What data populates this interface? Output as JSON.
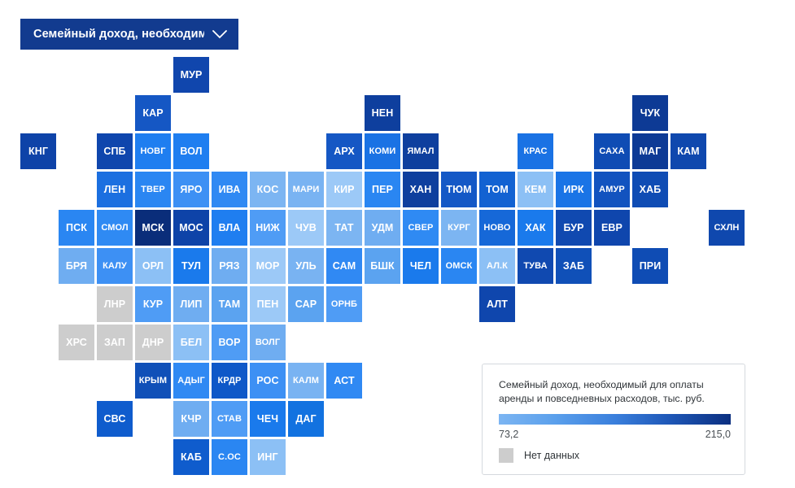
{
  "dropdown": {
    "label": "Семейный доход, необходим...",
    "icon": "chevron-down-icon",
    "bg_color": "#123b8f"
  },
  "legend": {
    "title": "Семейный доход, необходимый для оплаты аренды и повседневных расходов, тыс. руб.",
    "min_label": "73,2",
    "max_label": "215,0",
    "nodata_label": "Нет данных",
    "nodata_color": "#cdcdcd",
    "ramp_start_color": "#7cb5f2",
    "ramp_end_color": "#0b2f80"
  },
  "chart_data": {
    "type": "heatmap",
    "title": "Семейный доход, необходимый для оплаты аренды и повседневных расходов, тыс. руб.",
    "xlabel": "",
    "ylabel": "",
    "value_unit": "тыс. руб.",
    "vmin": 73.2,
    "vmax": 215.0,
    "grid": false,
    "legend_position": "bottom-right",
    "colormap": [
      "#7cb5f2",
      "#0b2f80"
    ],
    "nodata_color": "#cdcdcd",
    "cell_size": 44,
    "cell_pitch": 47,
    "origin": [
      25,
      70
    ],
    "tiles": [
      {
        "label": "МУР",
        "col": 4,
        "row": 0,
        "color": "#1046ad",
        "value": 140.0
      },
      {
        "label": "КАР",
        "col": 3,
        "row": 1,
        "color": "#1557c4",
        "value": 128.0
      },
      {
        "label": "НЕН",
        "col": 9,
        "row": 1,
        "color": "#0e3f9e",
        "value": 152.0
      },
      {
        "label": "ЧУК",
        "col": 16,
        "row": 1,
        "color": "#0d3a95",
        "value": 158.0
      },
      {
        "label": "КНГ",
        "col": 0,
        "row": 2,
        "color": "#0e43a8",
        "value": 146.0
      },
      {
        "label": "СПБ",
        "col": 2,
        "row": 2,
        "color": "#0f46ad",
        "value": 143.0
      },
      {
        "label": "НОВГ",
        "col": 3,
        "row": 2,
        "color": "#1f7ef0",
        "value": 106.0
      },
      {
        "label": "ВОЛ",
        "col": 4,
        "row": 2,
        "color": "#1f7ef0",
        "value": 105.0
      },
      {
        "label": "АРХ",
        "col": 8,
        "row": 2,
        "color": "#1557c4",
        "value": 129.0
      },
      {
        "label": "КОМИ",
        "col": 9,
        "row": 2,
        "color": "#1a72e4",
        "value": 113.0
      },
      {
        "label": "ЯМАЛ",
        "col": 10,
        "row": 2,
        "color": "#0e3f9e",
        "value": 151.0
      },
      {
        "label": "КРАС",
        "col": 13,
        "row": 2,
        "color": "#1a72e4",
        "value": 112.0
      },
      {
        "label": "САХА",
        "col": 15,
        "row": 2,
        "color": "#0f4cb4",
        "value": 140.0
      },
      {
        "label": "МАГ",
        "col": 16,
        "row": 2,
        "color": "#0d3a95",
        "value": 157.0
      },
      {
        "label": "КАМ",
        "col": 17,
        "row": 2,
        "color": "#0f48ae",
        "value": 144.0
      },
      {
        "label": "ЛЕН",
        "col": 2,
        "row": 3,
        "color": "#1b6fe0",
        "value": 115.0
      },
      {
        "label": "ТВЕР",
        "col": 3,
        "row": 3,
        "color": "#2a86f2",
        "value": 101.0
      },
      {
        "label": "ЯРО",
        "col": 4,
        "row": 3,
        "color": "#3d90f4",
        "value": 96.0
      },
      {
        "label": "ИВА",
        "col": 5,
        "row": 3,
        "color": "#3089f3",
        "value": 99.0
      },
      {
        "label": "КОС",
        "col": 6,
        "row": 3,
        "color": "#7cb5f2",
        "value": 82.0
      },
      {
        "label": "МАРИ",
        "col": 7,
        "row": 3,
        "color": "#79b3f2",
        "value": 83.0
      },
      {
        "label": "КИР",
        "col": 8,
        "row": 3,
        "color": "#9cc9f7",
        "value": 77.0
      },
      {
        "label": "ПЕР",
        "col": 9,
        "row": 3,
        "color": "#2a86f2",
        "value": 101.0
      },
      {
        "label": "ХАН",
        "col": 10,
        "row": 3,
        "color": "#0e3f9e",
        "value": 150.0
      },
      {
        "label": "ТЮМ",
        "col": 11,
        "row": 3,
        "color": "#1458c6",
        "value": 128.0
      },
      {
        "label": "ТОМ",
        "col": 12,
        "row": 3,
        "color": "#1262d2",
        "value": 123.0
      },
      {
        "label": "КЕМ",
        "col": 13,
        "row": 3,
        "color": "#8cc0f5",
        "value": 80.0
      },
      {
        "label": "ИРК",
        "col": 14,
        "row": 3,
        "color": "#1a74e6",
        "value": 112.0
      },
      {
        "label": "АМУР",
        "col": 15,
        "row": 3,
        "color": "#1253bf",
        "value": 131.0
      },
      {
        "label": "ХАБ",
        "col": 16,
        "row": 3,
        "color": "#0f4cb4",
        "value": 139.0
      },
      {
        "label": "ПСК",
        "col": 1,
        "row": 4,
        "color": "#2a86f2",
        "value": 100.0
      },
      {
        "label": "СМОЛ",
        "col": 2,
        "row": 4,
        "color": "#2f8af3",
        "value": 99.0
      },
      {
        "label": "МСК",
        "col": 3,
        "row": 4,
        "color": "#0a2d7a",
        "value": 215.0
      },
      {
        "label": "МОС",
        "col": 4,
        "row": 4,
        "color": "#0e43a8",
        "value": 147.0
      },
      {
        "label": "ВЛА",
        "col": 5,
        "row": 4,
        "color": "#1f7ef0",
        "value": 106.0
      },
      {
        "label": "НИЖ",
        "col": 6,
        "row": 4,
        "color": "#4f9cf5",
        "value": 92.0
      },
      {
        "label": "ЧУВ",
        "col": 7,
        "row": 4,
        "color": "#9cc9f7",
        "value": 77.0
      },
      {
        "label": "ТАТ",
        "col": 8,
        "row": 4,
        "color": "#7cb5f2",
        "value": 82.0
      },
      {
        "label": "УДМ",
        "col": 9,
        "row": 4,
        "color": "#6fadf1",
        "value": 85.0
      },
      {
        "label": "СВЕР",
        "col": 10,
        "row": 4,
        "color": "#2f8af3",
        "value": 98.0
      },
      {
        "label": "КУРГ",
        "col": 11,
        "row": 4,
        "color": "#7cb5f2",
        "value": 82.0
      },
      {
        "label": "НОВО",
        "col": 12,
        "row": 4,
        "color": "#1668d8",
        "value": 119.0
      },
      {
        "label": "ХАК",
        "col": 13,
        "row": 4,
        "color": "#1a7aec",
        "value": 110.0
      },
      {
        "label": "БУР",
        "col": 14,
        "row": 4,
        "color": "#1049b0",
        "value": 142.0
      },
      {
        "label": "ЕВР",
        "col": 15,
        "row": 4,
        "color": "#0f46ad",
        "value": 144.0
      },
      {
        "label": "СХЛН",
        "col": 18,
        "row": 4,
        "color": "#0f48ae",
        "value": 143.0
      },
      {
        "label": "БРЯ",
        "col": 1,
        "row": 5,
        "color": "#6fadf1",
        "value": 86.0
      },
      {
        "label": "КАЛУ",
        "col": 2,
        "row": 5,
        "color": "#3d90f4",
        "value": 96.0
      },
      {
        "label": "ОРЛ",
        "col": 3,
        "row": 5,
        "color": "#8cc0f5",
        "value": 80.0
      },
      {
        "label": "ТУЛ",
        "col": 4,
        "row": 5,
        "color": "#1a7aec",
        "value": 110.0
      },
      {
        "label": "РЯЗ",
        "col": 5,
        "row": 5,
        "color": "#6fadf1",
        "value": 86.0
      },
      {
        "label": "МОР",
        "col": 6,
        "row": 5,
        "color": "#9cc9f7",
        "value": 77.0
      },
      {
        "label": "УЛЬ",
        "col": 7,
        "row": 5,
        "color": "#79b3f2",
        "value": 83.0
      },
      {
        "label": "САМ",
        "col": 8,
        "row": 5,
        "color": "#3089f3",
        "value": 99.0
      },
      {
        "label": "БШК",
        "col": 9,
        "row": 5,
        "color": "#5ba3f0",
        "value": 90.0
      },
      {
        "label": "ЧЕЛ",
        "col": 10,
        "row": 5,
        "color": "#1a7aec",
        "value": 110.0
      },
      {
        "label": "ОМСК",
        "col": 11,
        "row": 5,
        "color": "#2a86f2",
        "value": 101.0
      },
      {
        "label": "АЛ.К",
        "col": 12,
        "row": 5,
        "color": "#8cc0f5",
        "value": 80.0
      },
      {
        "label": "ТУВА",
        "col": 13,
        "row": 5,
        "color": "#1049b0",
        "value": 142.0
      },
      {
        "label": "ЗАБ",
        "col": 14,
        "row": 5,
        "color": "#1050b8",
        "value": 135.0
      },
      {
        "label": "ПРИ",
        "col": 16,
        "row": 5,
        "color": "#0f4cb4",
        "value": 139.0
      },
      {
        "label": "ЛНР",
        "col": 2,
        "row": 6,
        "color": "#cdcdcd",
        "value": null
      },
      {
        "label": "КУР",
        "col": 3,
        "row": 6,
        "color": "#4f9cf5",
        "value": 92.0
      },
      {
        "label": "ЛИП",
        "col": 4,
        "row": 6,
        "color": "#6fadf1",
        "value": 86.0
      },
      {
        "label": "ТАМ",
        "col": 5,
        "row": 6,
        "color": "#5ba3f0",
        "value": 90.0
      },
      {
        "label": "ПЕН",
        "col": 6,
        "row": 6,
        "color": "#9cc9f7",
        "value": 77.0
      },
      {
        "label": "САР",
        "col": 7,
        "row": 6,
        "color": "#5ba3f0",
        "value": 90.0
      },
      {
        "label": "ОРНБ",
        "col": 8,
        "row": 6,
        "color": "#4f9cf5",
        "value": 92.0
      },
      {
        "label": "АЛТ",
        "col": 12,
        "row": 6,
        "color": "#0f46ad",
        "value": 145.0
      },
      {
        "label": "ХРС",
        "col": 1,
        "row": 7,
        "color": "#cdcdcd",
        "value": null
      },
      {
        "label": "ЗАП",
        "col": 2,
        "row": 7,
        "color": "#cdcdcd",
        "value": null
      },
      {
        "label": "ДНР",
        "col": 3,
        "row": 7,
        "color": "#cdcdcd",
        "value": null
      },
      {
        "label": "БЕЛ",
        "col": 4,
        "row": 7,
        "color": "#8cc0f5",
        "value": 80.0
      },
      {
        "label": "ВОР",
        "col": 5,
        "row": 7,
        "color": "#4f9cf5",
        "value": 92.0
      },
      {
        "label": "ВОЛГ",
        "col": 6,
        "row": 7,
        "color": "#6fadf1",
        "value": 86.0
      },
      {
        "label": "КРЫМ",
        "col": 3,
        "row": 8,
        "color": "#1050b8",
        "value": 134.0
      },
      {
        "label": "АДЫГ",
        "col": 4,
        "row": 8,
        "color": "#3089f3",
        "value": 99.0
      },
      {
        "label": "КРДР",
        "col": 5,
        "row": 8,
        "color": "#0f58c8",
        "value": 127.0
      },
      {
        "label": "РОС",
        "col": 6,
        "row": 8,
        "color": "#3d90f4",
        "value": 96.0
      },
      {
        "label": "КАЛМ",
        "col": 7,
        "row": 8,
        "color": "#79b3f2",
        "value": 83.0
      },
      {
        "label": "АСТ",
        "col": 8,
        "row": 8,
        "color": "#3089f3",
        "value": 99.0
      },
      {
        "label": "СВС",
        "col": 2,
        "row": 9,
        "color": "#0f5ccd",
        "value": 125.0
      },
      {
        "label": "КЧР",
        "col": 4,
        "row": 9,
        "color": "#6fadf1",
        "value": 86.0
      },
      {
        "label": "СТАВ",
        "col": 5,
        "row": 9,
        "color": "#4f9cf5",
        "value": 92.0
      },
      {
        "label": "ЧЕЧ",
        "col": 6,
        "row": 9,
        "color": "#1a7aec",
        "value": 110.0
      },
      {
        "label": "ДАГ",
        "col": 7,
        "row": 9,
        "color": "#1272e0",
        "value": 114.0
      },
      {
        "label": "КАБ",
        "col": 4,
        "row": 10,
        "color": "#0f5ccd",
        "value": 125.0
      },
      {
        "label": "С.ОС",
        "col": 5,
        "row": 10,
        "color": "#2a86f2",
        "value": 101.0
      },
      {
        "label": "ИНГ",
        "col": 6,
        "row": 10,
        "color": "#8cc0f5",
        "value": 80.0
      }
    ]
  }
}
